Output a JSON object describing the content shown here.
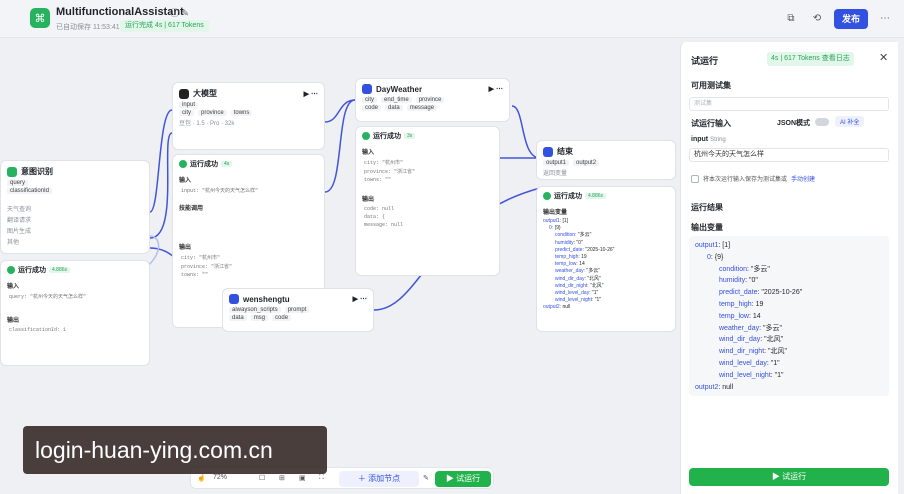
{
  "header": {
    "title": "MultifunctionalAssistant",
    "save_time": "已自动保存 11:53:41",
    "run_status": "运行完成 4s | 617 Tokens",
    "publish_label": "发布"
  },
  "nodes": {
    "intent": {
      "title": "意图识别",
      "inputs": [
        "query",
        "classificationId"
      ],
      "classes": [
        "天气查询",
        "翻译请求",
        "图片生成"
      ],
      "other": "其他",
      "ok": "运行成功",
      "time": "4.886s",
      "in_label": "输入",
      "in_value": "query: \"杭州今天的天气怎么样\"",
      "out_label": "输出",
      "out_value": "classificationId: 1"
    },
    "llm": {
      "title": "大模型",
      "input": "input",
      "outputs": [
        "city",
        "province",
        "towns"
      ],
      "model": "豆包 · 1.5 · Pro · 32k",
      "ok": "运行成功",
      "time": "4s",
      "in_label": "输入",
      "in_value": "input: \"杭州今天的天气怎么样\"",
      "skill": "技能调用",
      "out_label": "输出",
      "out_city": "city: \"杭州市\"",
      "out_province": "province: \"浙江省\"",
      "out_towns": "towns: \"\""
    },
    "weather": {
      "title": "DayWeather",
      "inputs": [
        "city",
        "end_time",
        "province"
      ],
      "outputs": [
        "code",
        "data",
        "message"
      ],
      "ok": "运行成功",
      "time": "3s",
      "in_label": "输入",
      "in_city": "city: \"杭州市\"",
      "in_province": "province: \"浙江省\"",
      "in_towns": "towns: \"\"",
      "out_label": "输出",
      "out_code": "code: null",
      "out_data": "data: {",
      "out_msg": "message: null"
    },
    "end": {
      "title": "结束",
      "outputs": [
        "output1",
        "output2"
      ],
      "mode": "返回变量",
      "ok": "运行成功",
      "time": "4.886s",
      "out_label": "输出变量"
    },
    "wensheng": {
      "title": "wenshengtu",
      "inputs": [
        "aiwayson_scripts",
        "prompt"
      ],
      "outputs": [
        "data",
        "msg",
        "code"
      ]
    }
  },
  "panel": {
    "title": "试运行",
    "stat": "4s | 617 Tokens  查看日志",
    "dataset_label": "可用测试集",
    "dataset_placeholder": "测试集",
    "input_label": "试运行输入",
    "json_mode": "JSON模式",
    "ai_fill": "AI 补全",
    "field_name": "input",
    "field_type": "String",
    "field_value": "杭州今天的天气怎么样",
    "save_text": "将本次运行输入保存为测试集或",
    "save_link": "手动创建",
    "result_label": "运行结果",
    "output_var_label": "输出变量",
    "output_tree": [
      {
        "k": "output1",
        "v": "[1]",
        "indent": 0
      },
      {
        "k": "0",
        "v": "{9}",
        "indent": 1
      },
      {
        "k": "condition",
        "v": "\"多云\"",
        "indent": 2
      },
      {
        "k": "humidity",
        "v": "\"0\"",
        "indent": 2
      },
      {
        "k": "predict_date",
        "v": "\"2025-10-26\"",
        "indent": 2
      },
      {
        "k": "temp_high",
        "v": "19",
        "indent": 2
      },
      {
        "k": "temp_low",
        "v": "14",
        "indent": 2
      },
      {
        "k": "weather_day",
        "v": "\"多云\"",
        "indent": 2
      },
      {
        "k": "wind_dir_day",
        "v": "\"北风\"",
        "indent": 2
      },
      {
        "k": "wind_dir_night",
        "v": "\"北风\"",
        "indent": 2
      },
      {
        "k": "wind_level_day",
        "v": "\"1\"",
        "indent": 2
      },
      {
        "k": "wind_level_night",
        "v": "\"1\"",
        "indent": 2
      },
      {
        "k": "output2",
        "v": "null",
        "indent": 0
      }
    ],
    "run_label": "试运行"
  },
  "bottom": {
    "zoom": "72%",
    "add_node": "添加节点",
    "test_run": "试运行"
  },
  "watermark": "login-huan-ying.com.cn",
  "colors": {
    "accent": "#3351e0",
    "success": "#22b24c"
  }
}
